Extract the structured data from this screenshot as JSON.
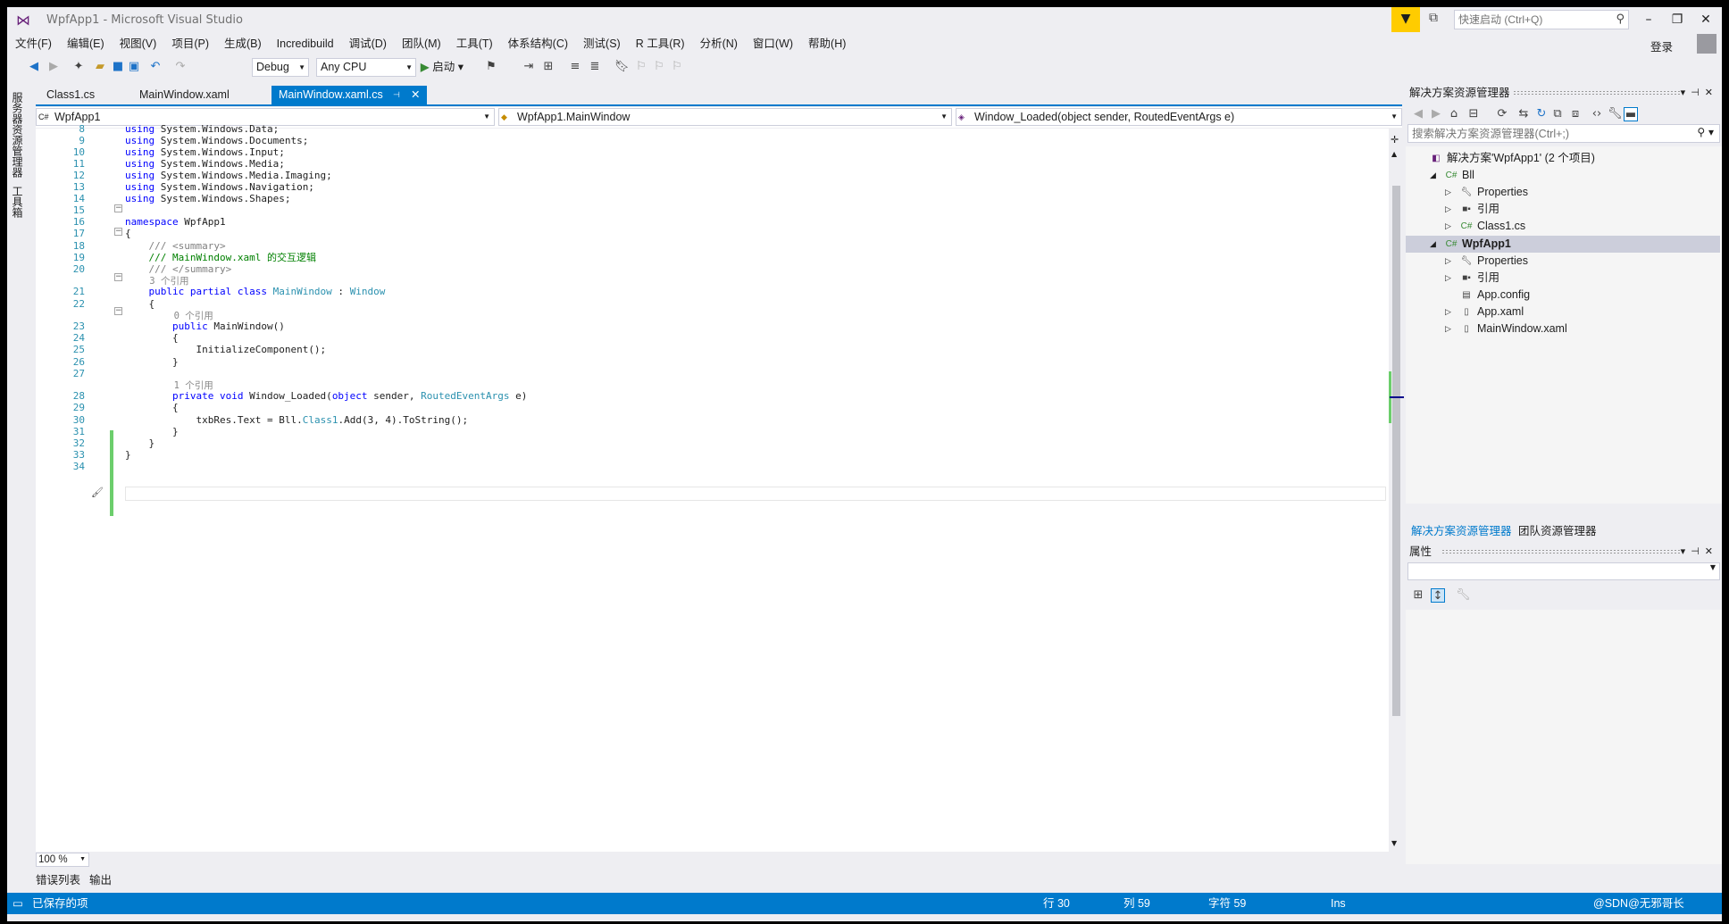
{
  "window": {
    "title": "WpfApp1 - Microsoft Visual Studio"
  },
  "quick_launch": {
    "placeholder": "快速启动 (Ctrl+Q)"
  },
  "menu": [
    "文件(F)",
    "编辑(E)",
    "视图(V)",
    "项目(P)",
    "生成(B)",
    "Incredibuild",
    "调试(D)",
    "团队(M)",
    "工具(T)",
    "体系结构(C)",
    "测试(S)",
    "R 工具(R)",
    "分析(N)",
    "窗口(W)",
    "帮助(H)"
  ],
  "login": "登录",
  "toolbar": {
    "config": "Debug",
    "platform": "Any CPU",
    "start": "启动"
  },
  "left_tabs": [
    "服务器资源管理器",
    "工具箱"
  ],
  "doc_tabs": [
    {
      "label": "Class1.cs",
      "active": false
    },
    {
      "label": "MainWindow.xaml",
      "active": false
    },
    {
      "label": "MainWindow.xaml.cs",
      "active": true
    }
  ],
  "nav": {
    "project": "WpfApp1",
    "type": "WpfApp1.MainWindow",
    "member": "Window_Loaded(object sender, RoutedEventArgs e)"
  },
  "code": {
    "line_numbers": [
      "8",
      "9",
      "10",
      "11",
      "12",
      "13",
      "14",
      "15",
      "16",
      "17",
      "18",
      "19",
      "20",
      "21",
      "22",
      "23",
      "24",
      "25",
      "26",
      "27",
      "28",
      "29",
      "30",
      "31",
      "32",
      "33",
      "34"
    ],
    "lines": [
      {
        "kw": "using",
        "rest": " System.Windows.Data;"
      },
      {
        "kw": "using",
        "rest": " System.Windows.Documents;"
      },
      {
        "kw": "using",
        "rest": " System.Windows.Input;"
      },
      {
        "kw": "using",
        "rest": " System.Windows.Media;"
      },
      {
        "kw": "using",
        "rest": " System.Windows.Media.Imaging;"
      },
      {
        "kw": "using",
        "rest": " System.Windows.Navigation;"
      },
      {
        "kw": "using",
        "rest": " System.Windows.Shapes;"
      }
    ],
    "ns_kw": "namespace",
    "ns_name": " WpfApp1",
    "doc1_prefix": "/// ",
    "doc1_tag": "<summary>",
    "doc2_prefix": "/// ",
    "doc2_text": "MainWindow.xaml 的交互逻辑",
    "doc3_prefix": "/// ",
    "doc3_tag": "</summary>",
    "refs_class": "3 个引用",
    "class_kw": "public partial class",
    "class_name": "MainWindow",
    "class_sep": " : ",
    "class_base": "Window",
    "refs_ctor": "0 个引用",
    "ctor_kw": "public",
    "ctor_rest": " MainWindow()",
    "ctor_body": "InitializeComponent();",
    "refs_loaded": "1 个引用",
    "m_kw1": "private",
    "m_kw2": "void",
    "m_name": " Window_Loaded(",
    "m_kw3": "object",
    "m_p1": " sender, ",
    "m_type": "RoutedEventArgs",
    "m_p2": " e)",
    "body_a": "txbRes.Text = Bll.",
    "body_type": "Class1",
    "body_b": ".Add(3, 4).ToString();",
    "open_brace": "{",
    "close_brace": "}"
  },
  "zoom": "100 %",
  "bottom_tabs": [
    "错误列表",
    "输出"
  ],
  "solution_explorer": {
    "title": "解决方案资源管理器",
    "search_placeholder": "搜索解决方案资源管理器(Ctrl+;)",
    "tree": [
      {
        "label": "解决方案'WpfApp1' (2 个项目)",
        "depth": 0,
        "twisty": "",
        "icon": "solution-icon",
        "bold": false,
        "selected": false
      },
      {
        "label": "Bll",
        "depth": 1,
        "twisty": "◢",
        "icon": "csharp-project-icon",
        "bold": false,
        "selected": false
      },
      {
        "label": "Properties",
        "depth": 2,
        "twisty": "▷",
        "icon": "wrench-icon",
        "bold": false,
        "selected": false
      },
      {
        "label": "引用",
        "depth": 2,
        "twisty": "▷",
        "icon": "references-icon",
        "bold": false,
        "selected": false
      },
      {
        "label": "Class1.cs",
        "depth": 2,
        "twisty": "▷",
        "icon": "csharp-file-icon",
        "bold": false,
        "selected": false
      },
      {
        "label": "WpfApp1",
        "depth": 1,
        "twisty": "◢",
        "icon": "csharp-project-icon",
        "bold": true,
        "selected": true
      },
      {
        "label": "Properties",
        "depth": 2,
        "twisty": "▷",
        "icon": "wrench-icon",
        "bold": false,
        "selected": false
      },
      {
        "label": "引用",
        "depth": 2,
        "twisty": "▷",
        "icon": "references-icon",
        "bold": false,
        "selected": false
      },
      {
        "label": "App.config",
        "depth": 2,
        "twisty": "",
        "icon": "config-file-icon",
        "bold": false,
        "selected": false
      },
      {
        "label": "App.xaml",
        "depth": 2,
        "twisty": "▷",
        "icon": "xaml-file-icon",
        "bold": false,
        "selected": false
      },
      {
        "label": "MainWindow.xaml",
        "depth": 2,
        "twisty": "▷",
        "icon": "xaml-file-icon",
        "bold": false,
        "selected": false
      }
    ],
    "tabs": [
      "解决方案资源管理器",
      "团队资源管理器"
    ]
  },
  "properties": {
    "title": "属性"
  },
  "status": {
    "message": "已保存的项",
    "line": "行 30",
    "col": "列 59",
    "char": "字符 59",
    "mode": "Ins",
    "watermark": "@SDN@无邪哥长"
  },
  "colors": {
    "accent": "#007acc",
    "keyword": "#0000ff",
    "type": "#2b91af",
    "comment": "#008000",
    "change_bar": "#6cce6c"
  }
}
